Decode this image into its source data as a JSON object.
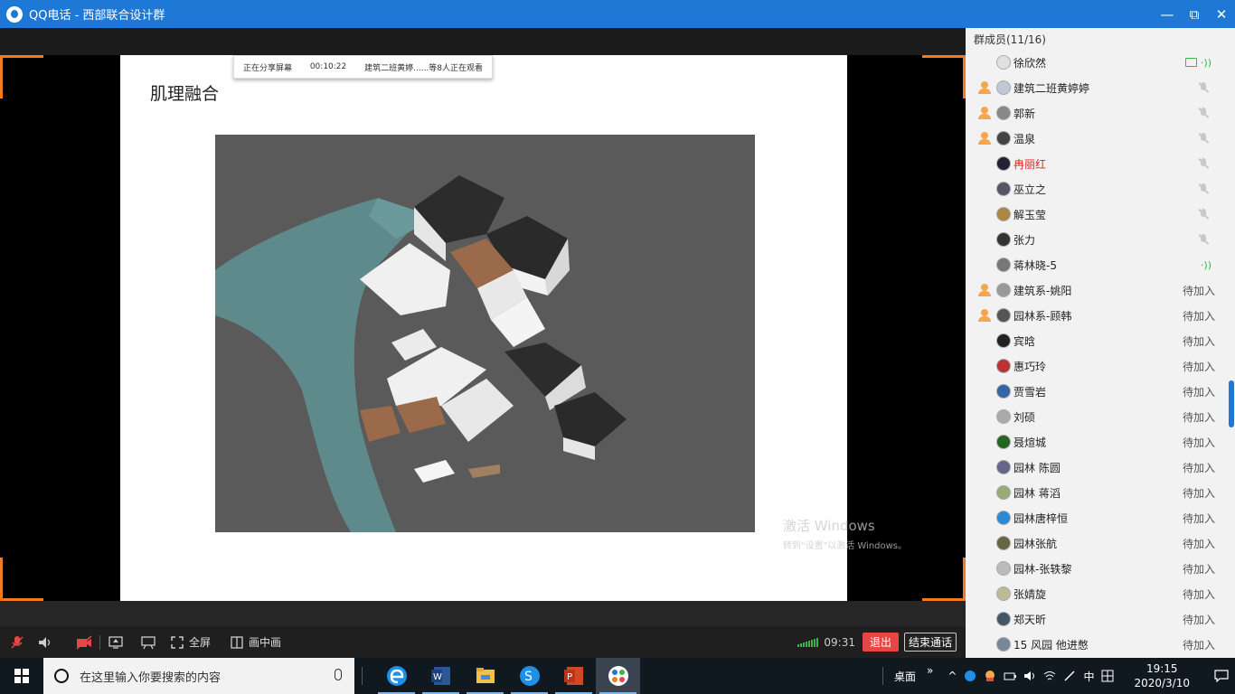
{
  "window": {
    "title": "QQ电话 - 西部联合设计群",
    "controls": {
      "minimize": "—",
      "restore": "⧉",
      "close": "✕"
    }
  },
  "share_banner": {
    "status": "正在分享屏幕",
    "duration": "00:10:22",
    "viewers": "建筑二班黄婷......等8人正在观看"
  },
  "slide": {
    "title": "肌理融合"
  },
  "watermark": {
    "line1": "激活 Windows",
    "line2": "转到\"设置\"以激活 Windows。"
  },
  "toolbar": {
    "fullscreen_label": "全屏",
    "pip_label": "画中画",
    "call_time": "09:31",
    "exit_label": "退出",
    "end_call_label": "结束通话"
  },
  "members": {
    "header": "群成员(11/16)",
    "list": [
      {
        "name": "徐欣然",
        "host": false,
        "state": "sharing",
        "status": ""
      },
      {
        "name": "建筑二班黄婷婷",
        "host": true,
        "state": "muted",
        "status": ""
      },
      {
        "name": "郭新",
        "host": true,
        "state": "muted",
        "status": ""
      },
      {
        "name": "温泉",
        "host": true,
        "state": "muted",
        "status": ""
      },
      {
        "name": "冉丽红",
        "host": false,
        "state": "muted",
        "status": "",
        "color": "#e02020"
      },
      {
        "name": "巫立之",
        "host": false,
        "state": "muted",
        "status": ""
      },
      {
        "name": "解玉莹",
        "host": false,
        "state": "muted",
        "status": ""
      },
      {
        "name": "张力",
        "host": false,
        "state": "muted",
        "status": ""
      },
      {
        "name": "蒋林晓-5",
        "host": false,
        "state": "speaking",
        "status": ""
      },
      {
        "name": "建筑系-姚阳",
        "host": true,
        "state": "waiting",
        "status": "待加入"
      },
      {
        "name": "园林系-顾韩",
        "host": true,
        "state": "waiting",
        "status": "待加入"
      },
      {
        "name": "宾晗",
        "host": false,
        "state": "waiting",
        "status": "待加入"
      },
      {
        "name": "惠巧玲",
        "host": false,
        "state": "waiting",
        "status": "待加入"
      },
      {
        "name": "贾雪岩",
        "host": false,
        "state": "waiting",
        "status": "待加入"
      },
      {
        "name": "刘硕",
        "host": false,
        "state": "waiting",
        "status": "待加入"
      },
      {
        "name": "聂煊城",
        "host": false,
        "state": "waiting",
        "status": "待加入"
      },
      {
        "name": "园林 陈圆",
        "host": false,
        "state": "waiting",
        "status": "待加入"
      },
      {
        "name": "园林 蒋滔",
        "host": false,
        "state": "waiting",
        "status": "待加入"
      },
      {
        "name": "园林唐梓恒",
        "host": false,
        "state": "waiting",
        "status": "待加入"
      },
      {
        "name": "园林张航",
        "host": false,
        "state": "waiting",
        "status": "待加入"
      },
      {
        "name": "园林-张轶黎",
        "host": false,
        "state": "waiting",
        "status": "待加入"
      },
      {
        "name": "张婧旋",
        "host": false,
        "state": "waiting",
        "status": "待加入"
      },
      {
        "name": "郑天昕",
        "host": false,
        "state": "waiting",
        "status": "待加入"
      },
      {
        "name": "15 风园 他进憋",
        "host": false,
        "state": "waiting",
        "status": "待加入"
      }
    ]
  },
  "taskbar": {
    "search_placeholder": "在这里输入你要搜索的内容",
    "desktop_label": "桌面",
    "ime": "中",
    "time": "19:15",
    "date": "2020/3/10"
  },
  "colors": {
    "titlebar": "#1d78d6",
    "accent_orange": "#f07b20",
    "exit_red": "#e84545",
    "online_green": "#3bb54a"
  }
}
